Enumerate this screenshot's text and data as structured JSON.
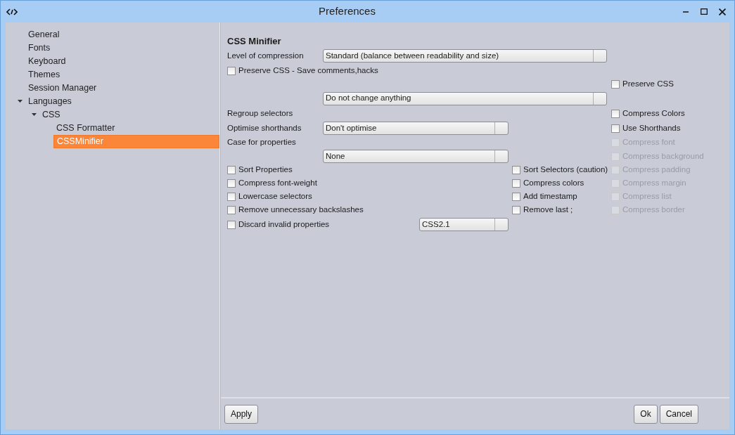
{
  "window": {
    "title": "Preferences"
  },
  "sidebar": {
    "items": [
      {
        "label": "General",
        "selected": false
      },
      {
        "label": "Fonts",
        "selected": false
      },
      {
        "label": "Keyboard",
        "selected": false
      },
      {
        "label": "Themes",
        "selected": false
      },
      {
        "label": "Session Manager",
        "selected": false
      },
      {
        "label": "Languages",
        "selected": false,
        "expanded": true,
        "children": [
          {
            "label": "CSS",
            "selected": false,
            "expanded": true,
            "children": [
              {
                "label": "CSS Formatter",
                "selected": false
              },
              {
                "label": "CSSMinifier",
                "selected": true
              }
            ]
          }
        ]
      }
    ]
  },
  "panel": {
    "title": "CSS Minifier",
    "controls": [
      {
        "kind": "label",
        "label": "Level of compression"
      },
      {
        "kind": "combo",
        "value": "Standard (balance between readability and size)"
      },
      {
        "kind": "checkbox",
        "label": "Preserve CSS -  Save comments,hacks",
        "checked": false,
        "disabled": false
      },
      {
        "kind": "checkbox",
        "label": "Preserve CSS",
        "checked": false,
        "disabled": false
      },
      {
        "kind": "combo",
        "value": "Do not change anything"
      },
      {
        "kind": "label",
        "label": "Regroup selectors"
      },
      {
        "kind": "checkbox",
        "label": "Compress Colors",
        "checked": false,
        "disabled": false
      },
      {
        "kind": "label",
        "label": "Optimise shorthands"
      },
      {
        "kind": "combo",
        "value": "Don't optimise"
      },
      {
        "kind": "checkbox",
        "label": "Use Shorthands",
        "checked": false,
        "disabled": false
      },
      {
        "kind": "label",
        "label": "Case for properties"
      },
      {
        "kind": "checkbox",
        "label": "Compress font",
        "checked": false,
        "disabled": true
      },
      {
        "kind": "combo",
        "value": "None"
      },
      {
        "kind": "checkbox",
        "label": "Compress background",
        "checked": false,
        "disabled": true
      },
      {
        "kind": "checkbox",
        "label": "Sort Properties",
        "checked": false,
        "disabled": false
      },
      {
        "kind": "checkbox",
        "label": "Sort Selectors (caution)",
        "checked": false,
        "disabled": false
      },
      {
        "kind": "checkbox",
        "label": "Compress padding",
        "checked": false,
        "disabled": true
      },
      {
        "kind": "checkbox",
        "label": "Compress font-weight",
        "checked": false,
        "disabled": false
      },
      {
        "kind": "checkbox",
        "label": "Compress colors",
        "checked": false,
        "disabled": false
      },
      {
        "kind": "checkbox",
        "label": "Compress margin",
        "checked": false,
        "disabled": true
      },
      {
        "kind": "checkbox",
        "label": "Lowercase selectors",
        "checked": false,
        "disabled": false
      },
      {
        "kind": "checkbox",
        "label": "Add timestamp",
        "checked": false,
        "disabled": false
      },
      {
        "kind": "checkbox",
        "label": "Compress list",
        "checked": false,
        "disabled": true
      },
      {
        "kind": "checkbox",
        "label": "Remove unnecessary backslashes",
        "checked": false,
        "disabled": false
      },
      {
        "kind": "checkbox",
        "label": "Remove last ;",
        "checked": false,
        "disabled": false
      },
      {
        "kind": "checkbox",
        "label": "Compress border",
        "checked": false,
        "disabled": true
      },
      {
        "kind": "checkbox",
        "label": "Discard invalid properties",
        "checked": false,
        "disabled": false
      },
      {
        "kind": "combo",
        "value": "CSS2.1"
      }
    ]
  },
  "buttons": {
    "left": [
      "Apply"
    ],
    "right": [
      "Ok",
      "Cancel"
    ]
  }
}
